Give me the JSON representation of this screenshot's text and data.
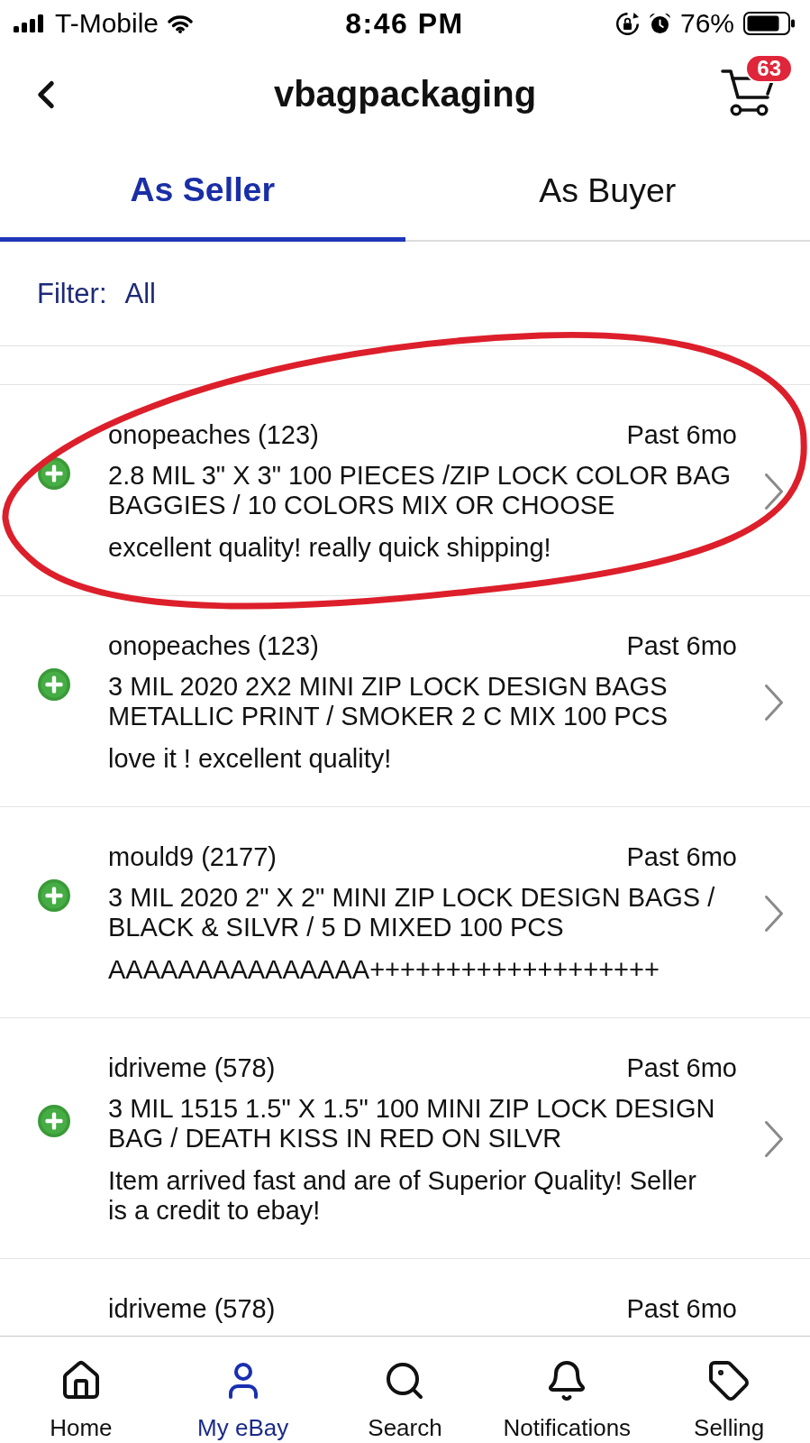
{
  "status_bar": {
    "carrier": "T-Mobile",
    "time": "8:46 PM",
    "battery": "76%"
  },
  "header": {
    "title": "vbagpackaging",
    "cart_count": "63"
  },
  "tabs": [
    {
      "label": "As Seller",
      "selected": true
    },
    {
      "label": "As Buyer",
      "selected": false
    }
  ],
  "filter": {
    "label": "Filter:",
    "value": "All"
  },
  "feedback": [
    {
      "kind": "positive",
      "seller": "onopeaches (123)",
      "period": "Past 6mo",
      "title": "2.8 MIL 3\" X 3\" 100 PIECES /ZIP LOCK COLOR BAG BAGGIES / 10 COLORS MIX OR CHOOSE",
      "comment": "excellent quality! really quick shipping!",
      "circled": true
    },
    {
      "kind": "positive",
      "seller": "onopeaches (123)",
      "period": "Past 6mo",
      "title": "3 MIL 2020 2X2 MINI ZIP LOCK DESIGN BAGS METALLIC PRINT / SMOKER 2 C MIX 100 PCS",
      "comment": "love it ! excellent quality!",
      "circled": false
    },
    {
      "kind": "positive",
      "seller": "mould9 (2177)",
      "period": "Past 6mo",
      "title": "3 MIL 2020 2\" X 2\" MINI ZIP LOCK DESIGN BAGS / BLACK & SILVR / 5 D MIXED 100 PCS",
      "comment": "AAAAAAAAAAAAAAA+++++++++++++++++++",
      "circled": false
    },
    {
      "kind": "positive",
      "seller": "idriveme (578)",
      "period": "Past 6mo",
      "title": "3 MIL 1515 1.5\" X 1.5\" 100 MINI ZIP LOCK DESIGN BAG / DEATH KISS IN RED ON SILVR",
      "comment": "Item arrived fast and are of Superior Quality! Seller is a credit to ebay!",
      "circled": false
    },
    {
      "seller": "idriveme (578)",
      "period": "Past 6mo",
      "circled": false
    }
  ],
  "bottom_nav": [
    {
      "label": "Home",
      "selected": false
    },
    {
      "label": "My eBay",
      "selected": true
    },
    {
      "label": "Search",
      "selected": false
    },
    {
      "label": "Notifications",
      "selected": false
    },
    {
      "label": "Selling",
      "selected": false
    }
  ]
}
